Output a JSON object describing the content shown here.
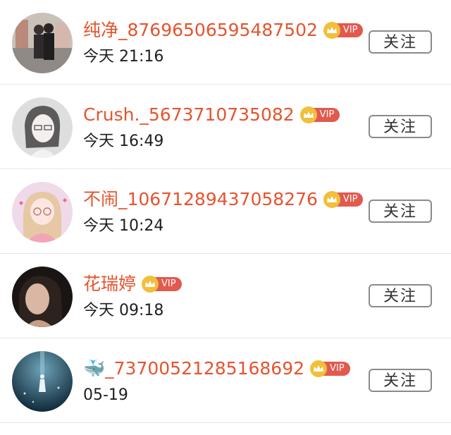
{
  "follow_label": "关注",
  "vip_label": "VIP",
  "colors": {
    "name": "#e5542f",
    "vip_badge": "#e2594e",
    "crown": "#f1bf3a"
  },
  "users": [
    {
      "name": "纯净_87696506595487502",
      "time": "今天 21:16",
      "vip": true,
      "avatar": "couple-photo-avatar"
    },
    {
      "name": "Crush._5673710735082",
      "time": "今天 16:49",
      "vip": true,
      "avatar": "sketch-girl-avatar"
    },
    {
      "name": "不闹_10671289437058276",
      "time": "今天 10:24",
      "vip": true,
      "avatar": "cartoon-girl-avatar"
    },
    {
      "name": "花瑞婷",
      "time": "今天 09:18",
      "vip": true,
      "avatar": "portrait-avatar"
    },
    {
      "name": "🐳_73700521285168692",
      "time": "05-19",
      "vip": true,
      "avatar": "underwater-avatar"
    }
  ]
}
